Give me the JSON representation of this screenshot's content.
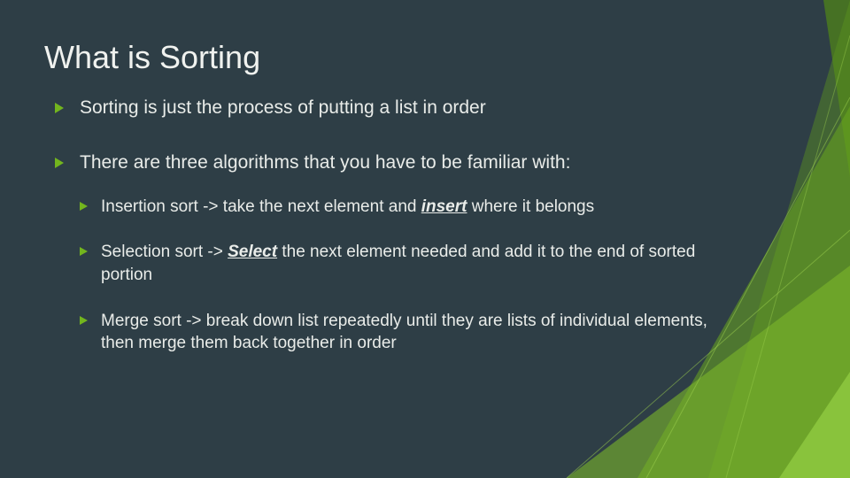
{
  "title": "What is Sorting",
  "bullets": [
    {
      "text": "Sorting is just the process of putting a list in order"
    },
    {
      "text": "There are three algorithms that you have to be familiar with:",
      "sub": [
        {
          "lead": "Insertion sort -> take the next element and ",
          "em_word": "insert",
          "em_class": "emui",
          "tail": " where it belongs"
        },
        {
          "lead": "Selection sort -> ",
          "em_word": "Select",
          "em_class": "embu",
          "tail": " the next element needed and add it to the end of sorted portion"
        },
        {
          "lead": "Merge sort ->  break down list repeatedly until they are lists of individual elements, then merge them back together in order",
          "em_word": "",
          "em_class": "",
          "tail": ""
        }
      ]
    }
  ],
  "colors": {
    "background": "#2e3e46",
    "bullet_arrow": "#73b51e",
    "text": "#e9ece9",
    "deco_dark": "#4a7a1f",
    "deco_mid": "#6aa51f",
    "deco_light": "#8ec93f"
  }
}
